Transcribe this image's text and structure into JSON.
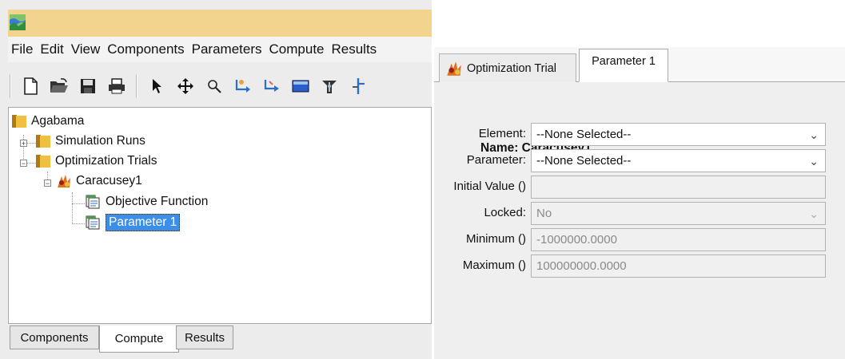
{
  "menu": [
    "File",
    "Edit",
    "View",
    "Components",
    "Parameters",
    "Compute",
    "Results"
  ],
  "toolbar_icons": [
    "new-icon",
    "open-icon",
    "save-icon",
    "print-icon",
    "arrow-icon",
    "move-icon",
    "zoom-icon",
    "add-element-icon",
    "connect-icon",
    "reservoir-icon",
    "junction-icon",
    "diversion-icon"
  ],
  "tree": {
    "root": "Agabama",
    "simulation_runs": "Simulation Runs",
    "optimization_trials": "Optimization Trials",
    "trial": "Caracusey1",
    "objective": "Objective Function",
    "parameter": "Parameter 1"
  },
  "bottom_tabs": [
    "Components",
    "Compute",
    "Results"
  ],
  "right_tabs": [
    "Optimization Trial",
    "Parameter 1"
  ],
  "form": {
    "name_label": "Name: Caracusey1",
    "element_label": "Element:",
    "element_value": "--None Selected--",
    "parameter_label": "Parameter:",
    "parameter_value": "--None Selected--",
    "initial_label": "Initial Value ()",
    "initial_value": "",
    "locked_label": "Locked:",
    "locked_value": "No",
    "minimum_label": "Minimum ()",
    "minimum_value": "-1000000.0000",
    "maximum_label": "Maximum ()",
    "maximum_value": "100000000.0000"
  },
  "colors": {
    "title_bar": "#f2d48f",
    "selection": "#3b8fe8",
    "folder": "#e8b020"
  }
}
